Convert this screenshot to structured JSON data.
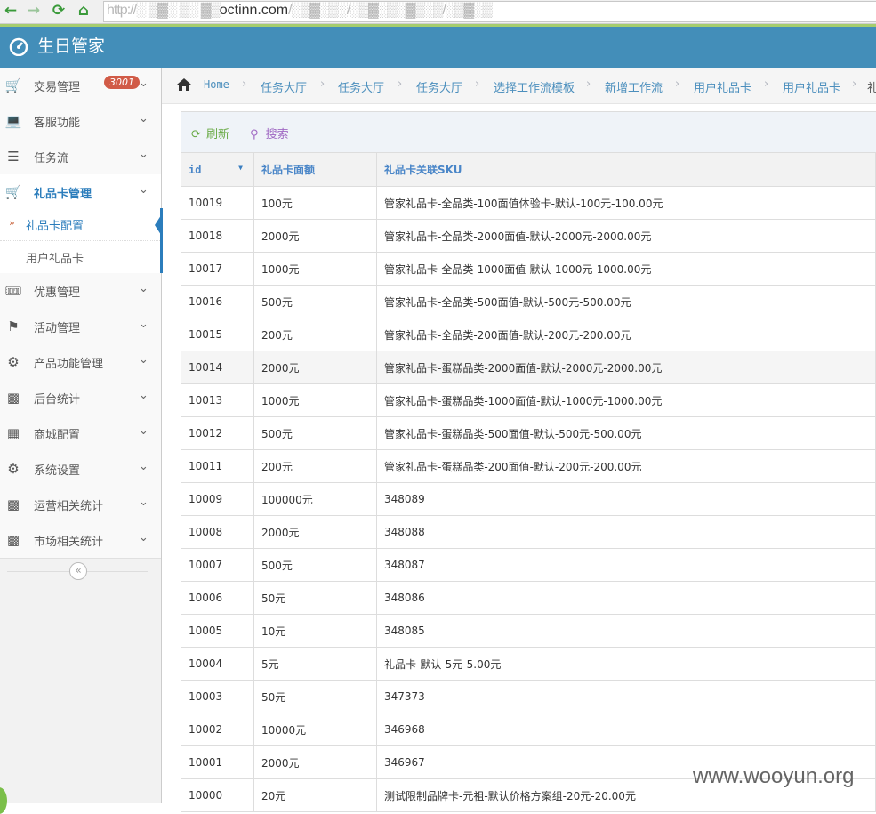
{
  "browser": {
    "url_host": "octinn.com",
    "url_before": "http://",
    "url_blurred_prefix": "░ ▒▓░ ▒░ ▓▒",
    "url_blurred_suffix": "/░▒▓░▒░/░▒▓░▒░▓▒░▒/░▒▓░▒"
  },
  "app": {
    "title": "生日管家",
    "accent": "#438eb9",
    "link": "#2b7dbc"
  },
  "sidebar": {
    "items": [
      {
        "label": "交易管理",
        "icon": "cart-icon",
        "badge": "3001"
      },
      {
        "label": "客服功能",
        "icon": "laptop-icon"
      },
      {
        "label": "任务流",
        "icon": "list-icon"
      },
      {
        "label": "礼品卡管理",
        "icon": "cart-icon",
        "active": true
      },
      {
        "label": "优惠管理",
        "icon": "ticket-icon"
      },
      {
        "label": "活动管理",
        "icon": "flag-icon"
      },
      {
        "label": "产品功能管理",
        "icon": "gear-icon"
      },
      {
        "label": "后台统计",
        "icon": "bar-chart-icon"
      },
      {
        "label": "商城配置",
        "icon": "sitemap-icon"
      },
      {
        "label": "系统设置",
        "icon": "gears-icon"
      },
      {
        "label": "运营相关统计",
        "icon": "bar-chart-icon"
      },
      {
        "label": "市场相关统计",
        "icon": "bar-chart-icon"
      }
    ],
    "sub_items": [
      {
        "label": "礼品卡配置",
        "active": true
      },
      {
        "label": "用户礼品卡"
      }
    ],
    "collapse_symbol": "«"
  },
  "breadcrumb": [
    "Home",
    "任务大厅",
    "任务大厅",
    "任务大厅",
    "选择工作流模板",
    "新增工作流",
    "用户礼品卡",
    "用户礼品卡",
    "礼"
  ],
  "toolbar": {
    "refresh_label": "刷新",
    "search_label": "搜索"
  },
  "table": {
    "columns": [
      "id",
      "礼品卡面额",
      "礼品卡关联SKU"
    ],
    "highlight_row": 5,
    "rows": [
      [
        "10019",
        "100元",
        "管家礼品卡-全品类-100面值体验卡-默认-100元-100.00元"
      ],
      [
        "10018",
        "2000元",
        "管家礼品卡-全品类-2000面值-默认-2000元-2000.00元"
      ],
      [
        "10017",
        "1000元",
        "管家礼品卡-全品类-1000面值-默认-1000元-1000.00元"
      ],
      [
        "10016",
        "500元",
        "管家礼品卡-全品类-500面值-默认-500元-500.00元"
      ],
      [
        "10015",
        "200元",
        "管家礼品卡-全品类-200面值-默认-200元-200.00元"
      ],
      [
        "10014",
        "2000元",
        "管家礼品卡-蛋糕品类-2000面值-默认-2000元-2000.00元"
      ],
      [
        "10013",
        "1000元",
        "管家礼品卡-蛋糕品类-1000面值-默认-1000元-1000.00元"
      ],
      [
        "10012",
        "500元",
        "管家礼品卡-蛋糕品类-500面值-默认-500元-500.00元"
      ],
      [
        "10011",
        "200元",
        "管家礼品卡-蛋糕品类-200面值-默认-200元-200.00元"
      ],
      [
        "10009",
        "100000元",
        "348089"
      ],
      [
        "10008",
        "2000元",
        "348088"
      ],
      [
        "10007",
        "500元",
        "348087"
      ],
      [
        "10006",
        "50元",
        "348086"
      ],
      [
        "10005",
        "10元",
        "348085"
      ],
      [
        "10004",
        "5元",
        "礼品卡-默认-5元-5.00元"
      ],
      [
        "10003",
        "50元",
        "347373"
      ],
      [
        "10002",
        "10000元",
        "346968"
      ],
      [
        "10001",
        "2000元",
        "346967"
      ],
      [
        "10000",
        "20元",
        "测试限制品牌卡-元祖-默认价格方案组-20元-20.00元"
      ]
    ]
  },
  "watermark": "www.wooyun.org"
}
